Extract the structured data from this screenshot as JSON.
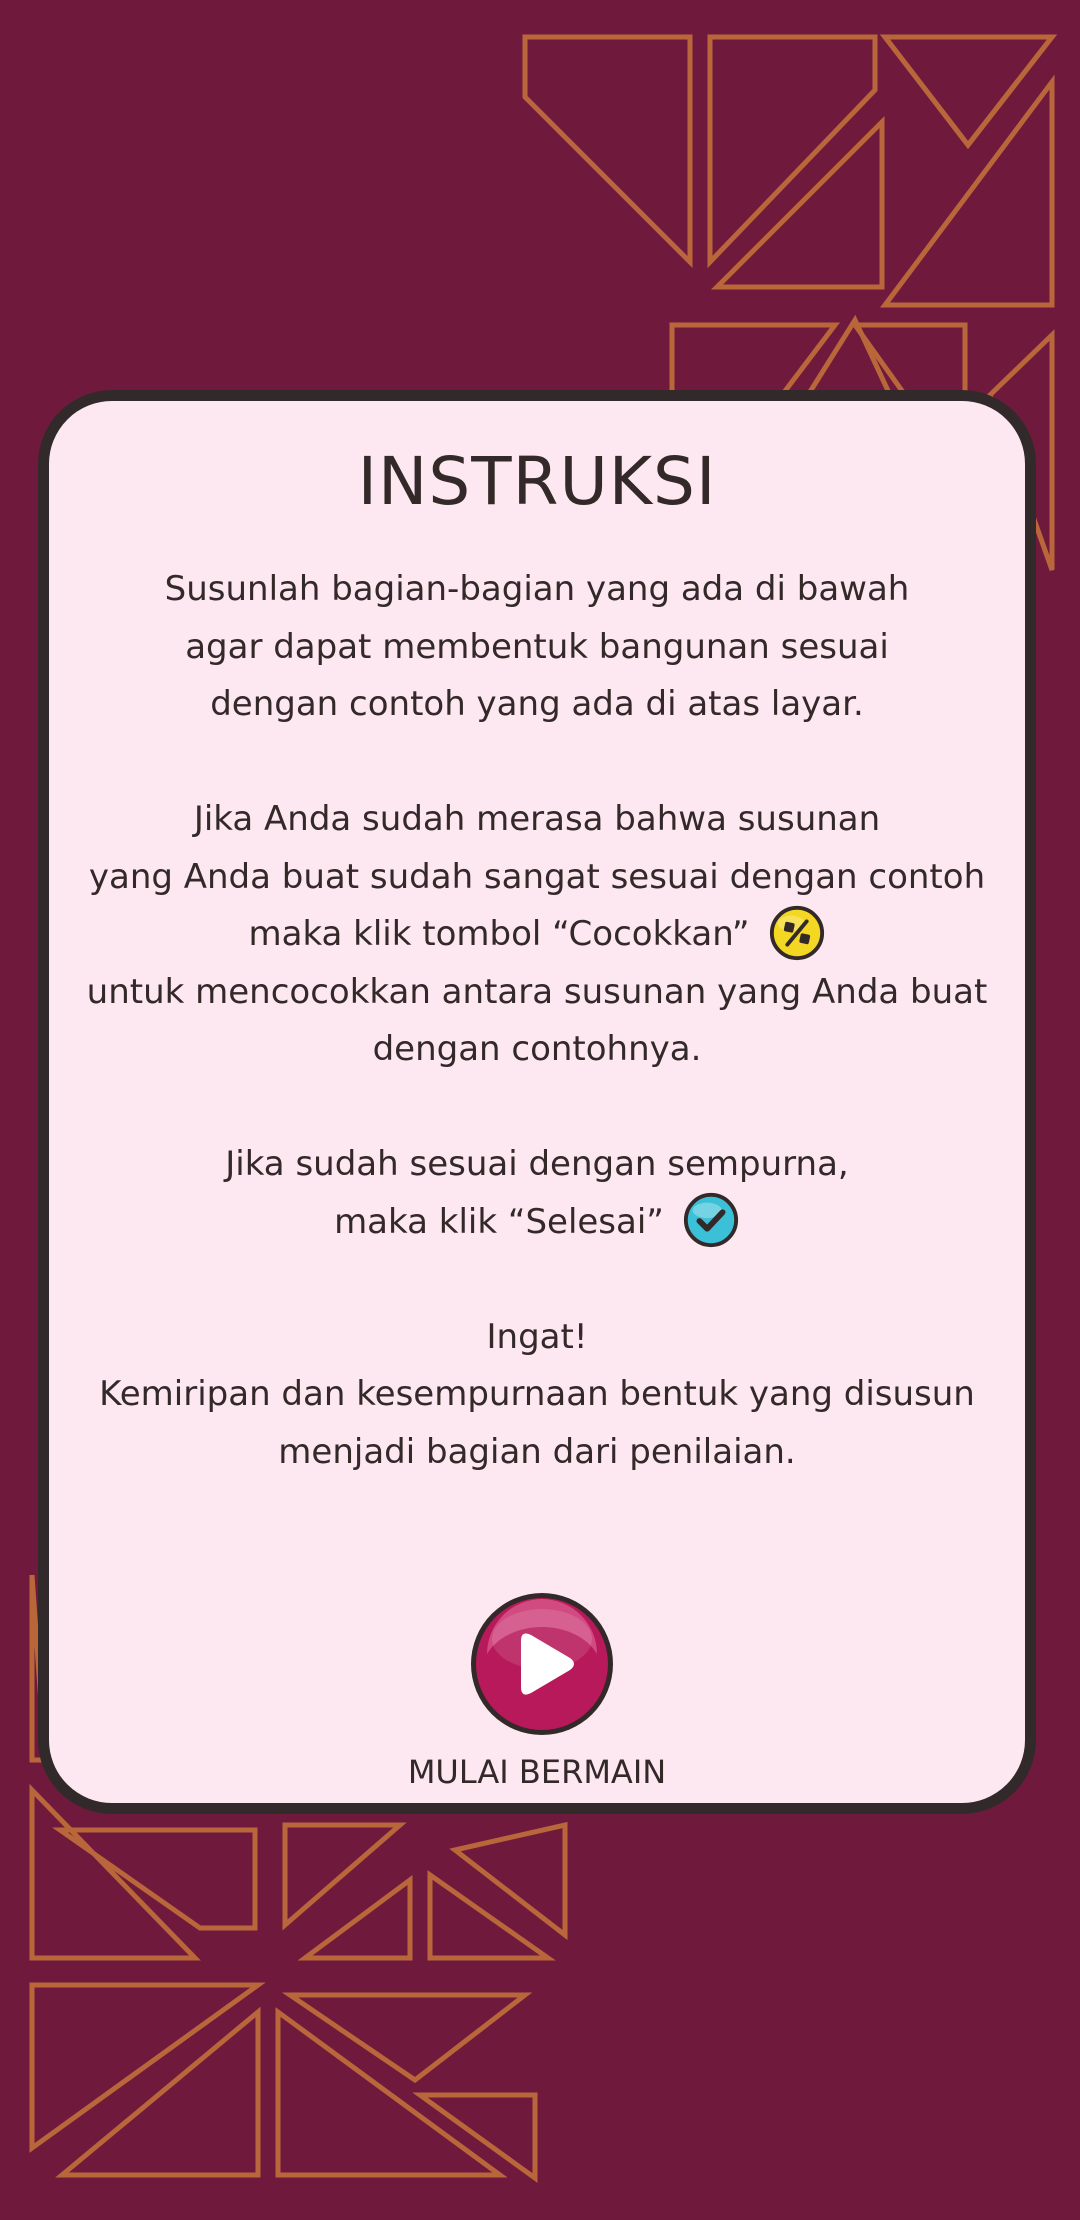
{
  "colors": {
    "background": "#6f1a3d",
    "pattern_stroke": "#b8663a",
    "card": "#fde8f1",
    "card_border": "#322a2a",
    "text": "#332929",
    "play_button": "#b8195a",
    "match_icon": "#f4d722",
    "done_icon": "#3bc0d8"
  },
  "instruction_card": {
    "title": "INSTRUKSI",
    "lines": [
      "Susunlah bagian-bagian yang ada di bawah",
      "agar dapat membentuk bangunan sesuai",
      "dengan contoh yang ada di atas layar.",
      "Jika Anda sudah merasa bahwa susunan",
      "yang  Anda buat sudah sangat sesuai dengan contoh",
      "maka klik tombol “Cocokkan”",
      "untuk mencocokkan antara susunan yang Anda buat",
      "dengan contohnya.",
      "Jika sudah sesuai dengan sempurna,",
      "maka klik “Selesai”",
      "Ingat!",
      "Kemiripan dan kesempurnaan bentuk yang disusun",
      "menjadi bagian dari penilaian."
    ],
    "icons": {
      "match": "percent-badge-icon",
      "done": "checkmark-badge-icon"
    }
  },
  "start_button": {
    "icon": "play-icon",
    "label": "MULAI BERMAIN"
  }
}
